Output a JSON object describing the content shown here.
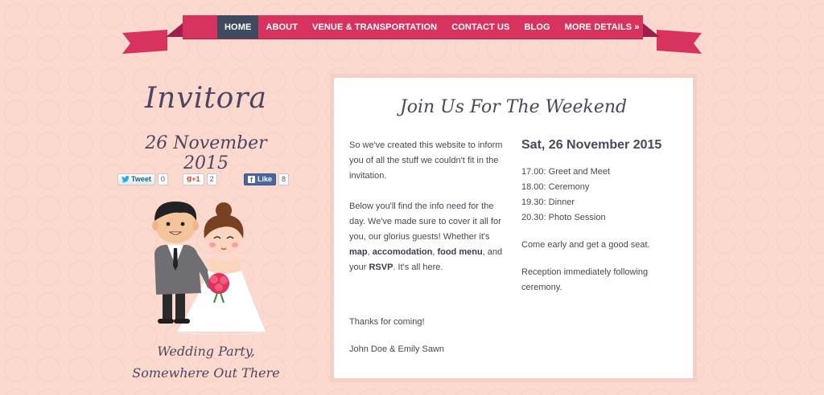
{
  "nav": {
    "items": [
      "HOME",
      "ABOUT",
      "VENUE & TRANSPORTATION",
      "CONTACT US",
      "BLOG",
      "MORE DETAILS »"
    ],
    "active": "HOME"
  },
  "brand": "Invitora",
  "event_date": "26 November 2015",
  "social": {
    "tweet_label": "Tweet",
    "tweet_count": "0",
    "gplus_label": "+1",
    "gplus_count": "2",
    "like_label": "Like",
    "like_count": "8"
  },
  "venue": {
    "line1": "Wedding Party,",
    "line2": "Somewhere Out There"
  },
  "card": {
    "title": "Join Us For The Weekend",
    "intro": "So we've created this website to inform you of all the stuff we couldn't fit in the invitation.",
    "body_pre": "Below you'll find the info need for the day. We've made sure to cover it all for you, our glorius guests! Whether it's",
    "link_map": "map",
    "link_accomodation": "accomodation",
    "link_food": "food menu",
    "sep_and": ", and your",
    "link_rsvp": "RSVP",
    "body_post": ". It's all here.",
    "thanks": "Thanks for coming!",
    "signature": "John Doe & Emily Sawn",
    "schedule_date": "Sat, 26 November 2015",
    "schedule": [
      "17.00: Greet and Meet",
      "18.00: Ceremony",
      "19.30: Dinner",
      "20.30: Photo Session"
    ],
    "note1": "Come early and get a good seat.",
    "note2": "Reception immediately following ceremony."
  },
  "colors": {
    "background": "#fbd9cf",
    "ribbon": "#d8335e",
    "nav_active": "#3f4a5e",
    "text": "#4a4657"
  },
  "icons": [
    "twitter-icon",
    "google-plus-icon",
    "facebook-icon",
    "couple-illustration"
  ]
}
